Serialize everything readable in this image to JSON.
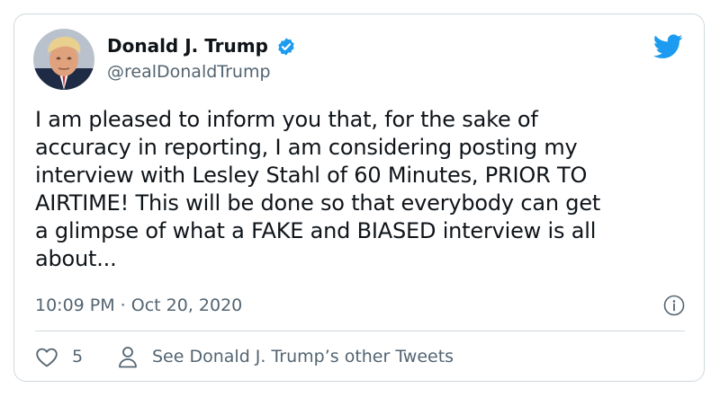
{
  "author": {
    "name": "Donald J. Trump",
    "handle": "@realDonaldTrump",
    "verified": true,
    "avatar_icon": "profile-photo"
  },
  "tweet": {
    "text": "I am pleased to inform you that, for the sake of\naccuracy in reporting, I am considering posting my\ninterview with Lesley Stahl of 60 Minutes, PRIOR TO\nAIRTIME! This will be done so that everybody can get\na glimpse of what a FAKE and BIASED interview is all\nabout...",
    "timestamp": "10:09 PM · Oct 20, 2020"
  },
  "actions": {
    "like_count": "5",
    "other_tweets_label": "See Donald J. Trump’s other Tweets"
  },
  "icons": {
    "brand": "twitter-bird-icon",
    "verified": "verified-badge-icon",
    "info": "info-icon",
    "like": "heart-icon",
    "profile": "person-icon"
  },
  "colors": {
    "brand_blue": "#1d9bf0",
    "text_primary": "#0f1419",
    "text_secondary": "#536471",
    "border": "#cfd9de"
  }
}
